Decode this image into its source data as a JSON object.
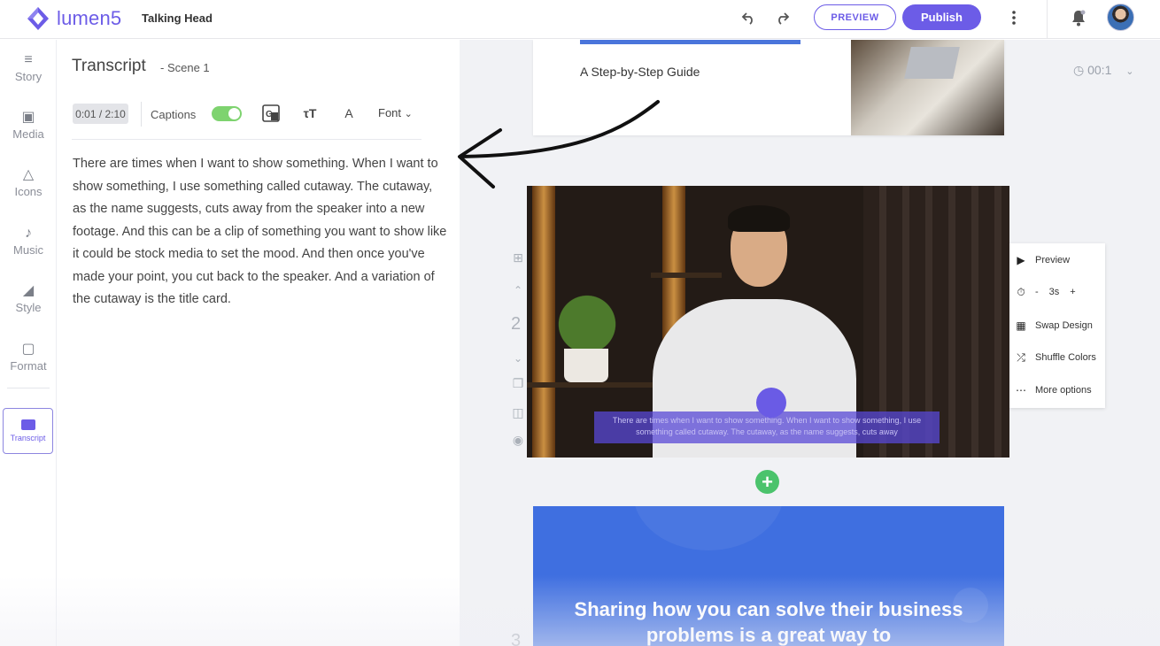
{
  "app": {
    "name": "lumen5",
    "project_title": "Talking Head"
  },
  "topbar": {
    "preview_label": "PREVIEW",
    "publish_label": "Publish"
  },
  "rail": {
    "items": [
      {
        "label": "Story",
        "icon": "story-icon"
      },
      {
        "label": "Media",
        "icon": "media-icon"
      },
      {
        "label": "Icons",
        "icon": "icons-icon"
      },
      {
        "label": "Music",
        "icon": "music-icon"
      },
      {
        "label": "Style",
        "icon": "style-icon"
      },
      {
        "label": "Format",
        "icon": "format-icon"
      }
    ],
    "active": {
      "label": "Transcript",
      "icon": "transcript-icon"
    }
  },
  "panel": {
    "title": "Transcript",
    "subtitle": "- Scene 1",
    "time": "0:01 / 2:10",
    "captions_label": "Captions",
    "captions_on": true,
    "font_label": "Font",
    "text": "There are times when I want to show something. When I want to show something, I use something called cutaway. The cutaway, as the name suggests, cuts away from the speaker into a new footage. And this can be a clip of something you want to show like it could be stock media to set the mood. And then once you've made your point, you cut back to the speaker. And a variation of the cutaway is the title card."
  },
  "canvas": {
    "scene1_text": "A Step-by-Step Guide",
    "timecode": "00:1",
    "scene2_number": "2",
    "scene3_number": "3",
    "scene2_caption": "There are times when I want to show something. When I want to show something, I use something called cutaway. The cutaway, as the name suggests, cuts away",
    "scene3_text": "Sharing how you can solve their business problems is a great way to",
    "context_menu": {
      "preview": "Preview",
      "duration_minus": "-",
      "duration": "3s",
      "duration_plus": "+",
      "swap_design": "Swap Design",
      "shuffle_colors": "Shuffle Colors",
      "more_options": "More options"
    }
  },
  "colors": {
    "accent": "#6c5ce7",
    "toggle_on": "#7ed36f",
    "scene3_bg": "#3f6fe0",
    "add_button": "#4bc36c"
  }
}
